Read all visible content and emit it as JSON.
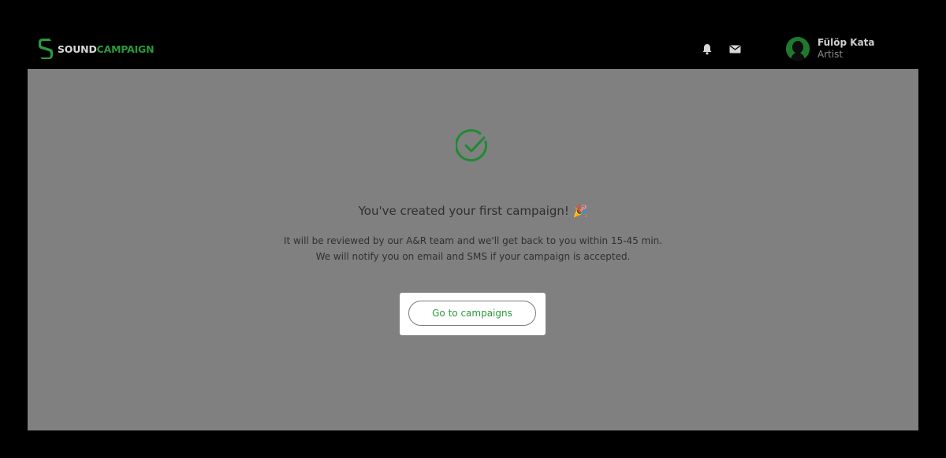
{
  "brand": {
    "name_part1": "SOUND",
    "name_part2": "CAMPAIGN",
    "accent_color": "#2a9a3c"
  },
  "header": {
    "icons": [
      "bell-icon",
      "mail-icon"
    ],
    "user": {
      "name": "Fülöp Kata",
      "role": "Artist"
    }
  },
  "main": {
    "status_icon": "check-circle-icon",
    "title": "You've created your first campaign! 🎉",
    "description_line1": "It will be reviewed by our A&R team and we'll get back to you within 15-45 min.",
    "description_line2": "We will notify you on email and SMS if your campaign is accepted.",
    "cta_label": "Go to campaigns"
  }
}
